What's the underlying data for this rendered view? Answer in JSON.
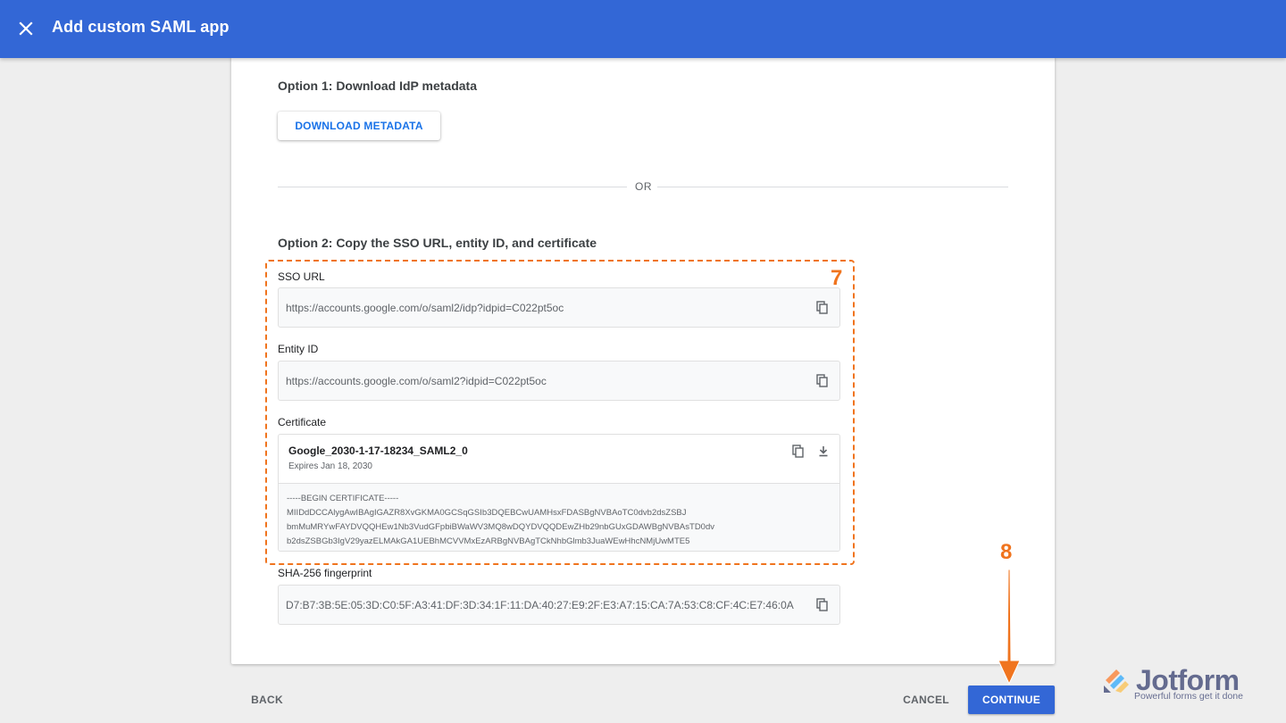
{
  "header": {
    "title": "Add custom SAML app",
    "close_icon": "close-icon"
  },
  "option1": {
    "title": "Option 1: Download IdP metadata",
    "download_label": "DOWNLOAD METADATA"
  },
  "divider_text": "OR",
  "option2": {
    "title": "Option 2: Copy the SSO URL, entity ID, and certificate",
    "sso_url": {
      "label": "SSO URL",
      "value": "https://accounts.google.com/o/saml2/idp?idpid=C022pt5oc"
    },
    "entity_id": {
      "label": "Entity ID",
      "value": "https://accounts.google.com/o/saml2?idpid=C022pt5oc"
    },
    "certificate": {
      "label": "Certificate",
      "name": "Google_2030-1-17-18234_SAML2_0",
      "expires": "Expires Jan 18, 2030",
      "lines": [
        "-----BEGIN CERTIFICATE-----",
        "MIIDdDCCAlygAwIBAgIGAZR8XvGKMA0GCSqGSIb3DQEBCwUAMHsxFDASBgNVBAoTC0dvb2dsZSBJ",
        "bmMuMRYwFAYDVQQHEw1Nb3VudGFpbiBWaWV3MQ8wDQYDVQQDEwZHb29nbGUxGDAWBgNVBAsTD0dv",
        "b2dsZSBGb3IgV29yazELMAkGA1UEBhMCVVMxEzARBgNVBAgTCkNhbGlmb3JuaWEwHhcNMjUwMTE5"
      ]
    },
    "fingerprint": {
      "label": "SHA-256 fingerprint",
      "value": "D7:B7:3B:5E:05:3D:C0:5F:A3:41:DF:3D:34:1F:11:DA:40:27:E9:2F:E3:A7:15:CA:7A:53:C8:CF:4C:E7:46:0A"
    }
  },
  "annotations": {
    "step7": "7",
    "step8": "8",
    "color": "#f0741e"
  },
  "footer": {
    "back_label": "BACK",
    "cancel_label": "CANCEL",
    "continue_label": "CONTINUE"
  },
  "watermark": {
    "brand": "Jotform",
    "tagline": "Powerful forms get it done"
  },
  "colors": {
    "header_bg": "#3367d6",
    "primary_button": "#3367d6",
    "link_text": "#1a73e8"
  }
}
